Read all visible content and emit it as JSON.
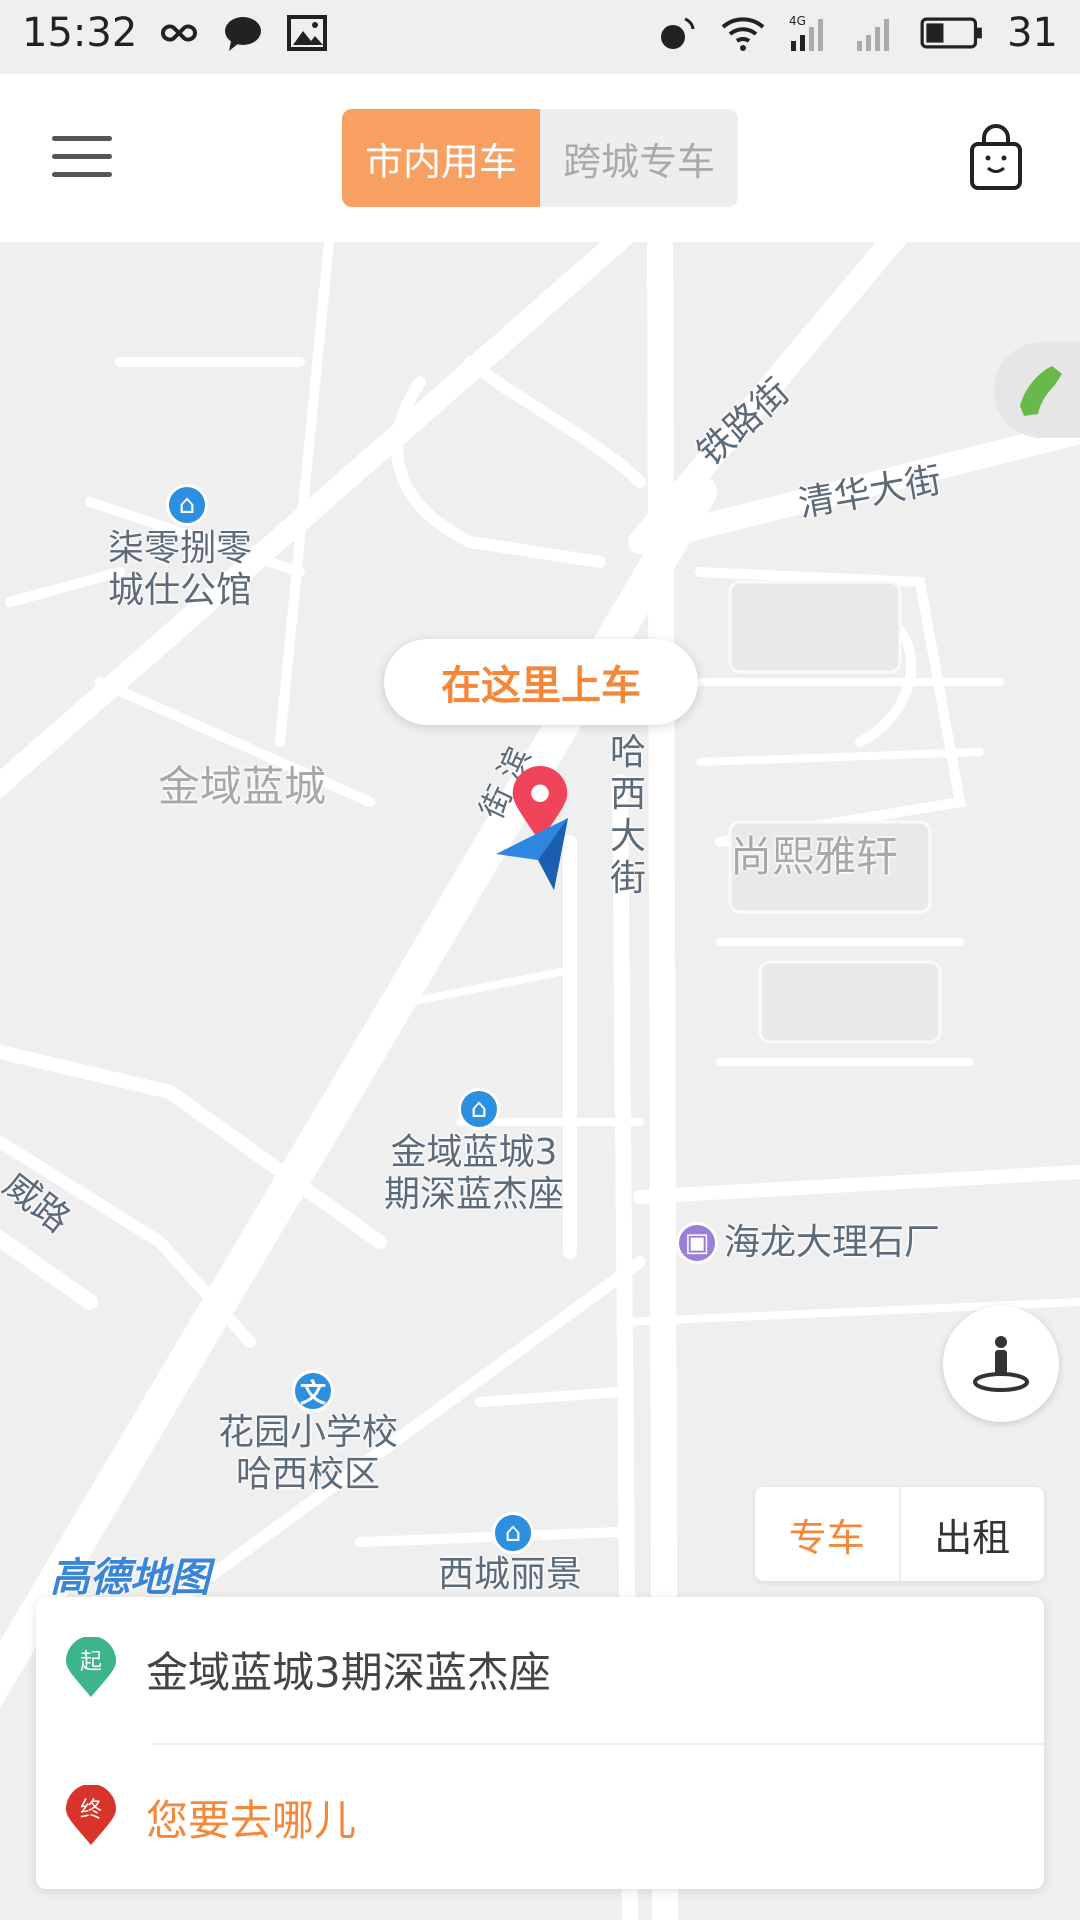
{
  "status_bar": {
    "time": "15:32",
    "battery": "31",
    "network": "4G",
    "left_icons": [
      "infinity-icon",
      "chat-bubble-icon",
      "image-icon"
    ],
    "right_icons": [
      "vibrate-icon",
      "wifi-icon",
      "signal-4g-icon",
      "signal-no-sim-icon",
      "battery-icon"
    ]
  },
  "header": {
    "tabs": [
      {
        "label": "市内用车",
        "active": true
      },
      {
        "label": "跨城专车",
        "active": false
      }
    ],
    "menu_icon": "hamburger-menu-icon",
    "shop_icon": "shopping-bag-icon"
  },
  "map": {
    "pickup_bubble": "在这里上车",
    "labels": {
      "poi_1": [
        "柒零捌零",
        "城仕公馆"
      ],
      "area_jinyu": "金域蓝城",
      "road_tielu": "铁路街",
      "road_qinghua": "清华大街",
      "road_haxi": "哈西大街",
      "road_bin_fragment": "街 滨",
      "area_shangxi": "尚熙雅轩",
      "poi_jinyu3": [
        "金域蓝城3",
        "期深蓝杰座"
      ],
      "road_wei": "威路",
      "poi_marble": "海龙大理石厂",
      "poi_school": [
        "花园小学校",
        "哈西校区"
      ],
      "poi_xicheng": "西城丽景",
      "school_icon_text": "文"
    },
    "logo": "高德地图",
    "controls": {
      "phone_icon": "phone-icon",
      "locate_icon": "person-locate-icon"
    }
  },
  "service_toggle": [
    {
      "label": "专车",
      "active": true
    },
    {
      "label": "出租",
      "active": false
    }
  ],
  "address_card": {
    "start_marker": "起",
    "start_address": "金域蓝城3期深蓝杰座",
    "end_marker": "终",
    "end_placeholder": "您要去哪儿"
  },
  "colors": {
    "accent": "#f8a062",
    "accent_text": "#f5873a",
    "start_green": "#3cb48c",
    "end_red": "#d9342b",
    "poi_blue": "#2d8fe0"
  }
}
